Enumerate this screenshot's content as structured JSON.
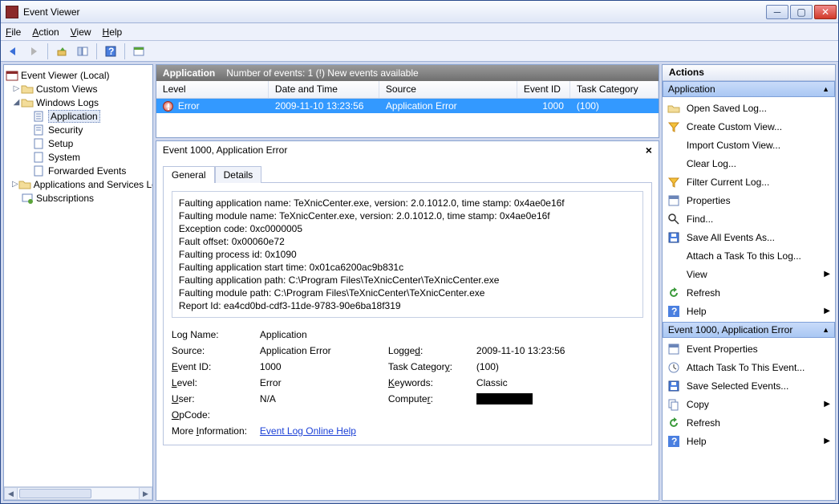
{
  "window": {
    "title": "Event Viewer"
  },
  "menus": {
    "file": "File",
    "action": "Action",
    "view": "View",
    "help": "Help"
  },
  "tree": {
    "root": "Event Viewer (Local)",
    "custom_views": "Custom Views",
    "windows_logs": "Windows Logs",
    "wl": {
      "application": "Application",
      "security": "Security",
      "setup": "Setup",
      "system": "System",
      "forwarded": "Forwarded Events"
    },
    "apps_services": "Applications and Services Lo",
    "subscriptions": "Subscriptions"
  },
  "grid": {
    "header_title": "Application",
    "header_info": "Number of events: 1 (!) New events available",
    "cols": {
      "level": "Level",
      "date": "Date and Time",
      "source": "Source",
      "eventid": "Event ID",
      "taskcat": "Task Category"
    },
    "row0": {
      "level": "Error",
      "date": "2009-11-10 13:23:56",
      "source": "Application Error",
      "eventid": "1000",
      "taskcat": "(100)"
    }
  },
  "detail": {
    "title": "Event 1000, Application Error",
    "tabs": {
      "general": "General",
      "details": "Details"
    },
    "msg": {
      "l1": "Faulting application name: TeXnicCenter.exe, version: 2.0.1012.0, time stamp: 0x4ae0e16f",
      "l2": "Faulting module name: TeXnicCenter.exe, version: 2.0.1012.0, time stamp: 0x4ae0e16f",
      "l3": "Exception code: 0xc0000005",
      "l4": "Fault offset: 0x00060e72",
      "l5": "Faulting process id: 0x1090",
      "l6": "Faulting application start time: 0x01ca6200ac9b831c",
      "l7": "Faulting application path: C:\\Program Files\\TeXnicCenter\\TeXnicCenter.exe",
      "l8": "Faulting module path: C:\\Program Files\\TeXnicCenter\\TeXnicCenter.exe",
      "l9": "Report Id: ea4cd0bd-cdf3-11de-9783-90e6ba18f319"
    },
    "kv": {
      "logname_l": "Log Name:",
      "logname_v": "Application",
      "source_l": "Source:",
      "source_v": "Application Error",
      "logged_l": "Logged:",
      "logged_v": "2009-11-10 13:23:56",
      "eventid_l": "Event ID:",
      "eventid_v": "1000",
      "taskcat_l": "Task Category:",
      "taskcat_v": "(100)",
      "level_l": "Level:",
      "level_v": "Error",
      "keywords_l": "Keywords:",
      "keywords_v": "Classic",
      "user_l": "User:",
      "user_v": "N/A",
      "computer_l": "Computer:",
      "opcode_l": "OpCode:",
      "moreinfo_l": "More Information:",
      "moreinfo_v": "Event Log Online Help"
    }
  },
  "actions": {
    "title": "Actions",
    "section1": "Application",
    "s1": {
      "open": "Open Saved Log...",
      "create": "Create Custom View...",
      "import": "Import Custom View...",
      "clear": "Clear Log...",
      "filter": "Filter Current Log...",
      "props": "Properties",
      "find": "Find...",
      "saveall": "Save All Events As...",
      "attach": "Attach a Task To this Log...",
      "view": "View",
      "refresh": "Refresh",
      "help": "Help"
    },
    "section2": "Event 1000, Application Error",
    "s2": {
      "evtprops": "Event Properties",
      "attachtask": "Attach Task To This Event...",
      "savesel": "Save Selected Events...",
      "copy": "Copy",
      "refresh": "Refresh",
      "help": "Help"
    }
  }
}
